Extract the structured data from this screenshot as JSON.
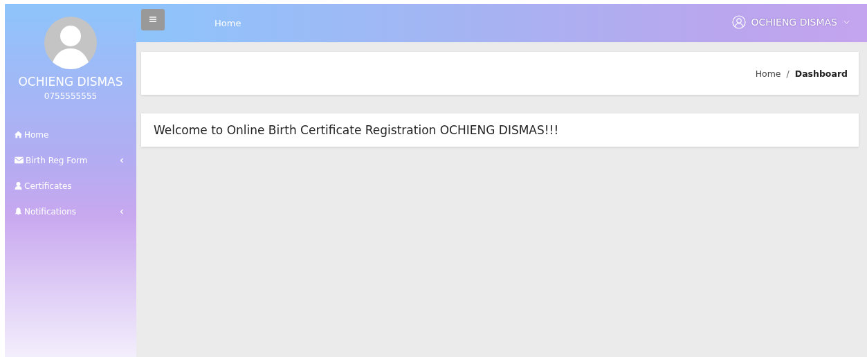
{
  "sidebar": {
    "user_name": "OCHIENG DISMAS",
    "phone": "0755555555",
    "items": [
      {
        "label": "Home"
      },
      {
        "label": "Birth Reg Form",
        "expanded": false
      },
      {
        "label": "Certificates"
      },
      {
        "label": "Notifications",
        "expanded": false
      }
    ]
  },
  "topbar": {
    "link": "Home",
    "user_name": "OCHIENG DISMAS"
  },
  "breadcrumb_separator": "/",
  "breadcrumb": [
    {
      "label": "Home",
      "selected": false
    },
    {
      "label": "Dashboard",
      "selected": true
    }
  ],
  "welcome": "Welcome to Online Birth Certificate Registration OCHIENG DISMAS!!!"
}
